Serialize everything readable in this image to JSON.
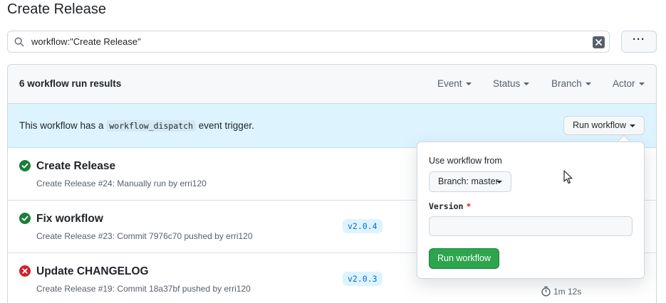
{
  "page": {
    "title": "Create Release"
  },
  "search": {
    "query": "workflow:\"Create Release\"",
    "search_icon": "search-icon",
    "clear_icon": "x-icon"
  },
  "more_button": {
    "icon": "kebab-horizontal-icon"
  },
  "results": {
    "count_label": "6 workflow run results",
    "filters": [
      {
        "label": "Event"
      },
      {
        "label": "Status"
      },
      {
        "label": "Branch"
      },
      {
        "label": "Actor"
      }
    ]
  },
  "dispatch": {
    "text_before": "This workflow has a",
    "code": "workflow_dispatch",
    "text_after": "event trigger.",
    "run_button_label": "Run workflow"
  },
  "runs": [
    {
      "title": "Create Release",
      "subtitle": "Create Release #24: Manually run by erri120",
      "status": "success",
      "status_icon": "check-circle-icon",
      "tag": "",
      "duration": ""
    },
    {
      "title": "Fix workflow",
      "subtitle": "Create Release #23: Commit 7976c70 pushed by erri120",
      "status": "success",
      "status_icon": "check-circle-icon",
      "tag": "v2.0.4",
      "duration": ""
    },
    {
      "title": "Update CHANGELOG",
      "subtitle": "Create Release #19: Commit 18a37bf pushed by erri120",
      "status": "failure",
      "status_icon": "x-circle-icon",
      "tag": "v2.0.3",
      "duration": "1m 12s"
    }
  ],
  "popover": {
    "use_from_label": "Use workflow from",
    "branch_button_label": "Branch: master",
    "version_label": "Version",
    "version_required_mark": "*",
    "version_value": "",
    "version_placeholder": "",
    "submit_label": "Run workflow"
  },
  "colors": {
    "success": "#1a7f37",
    "failure": "#cf222e",
    "accent": "#0969da",
    "primary_button": "#2da44e",
    "info_bg": "#ddf4ff"
  }
}
